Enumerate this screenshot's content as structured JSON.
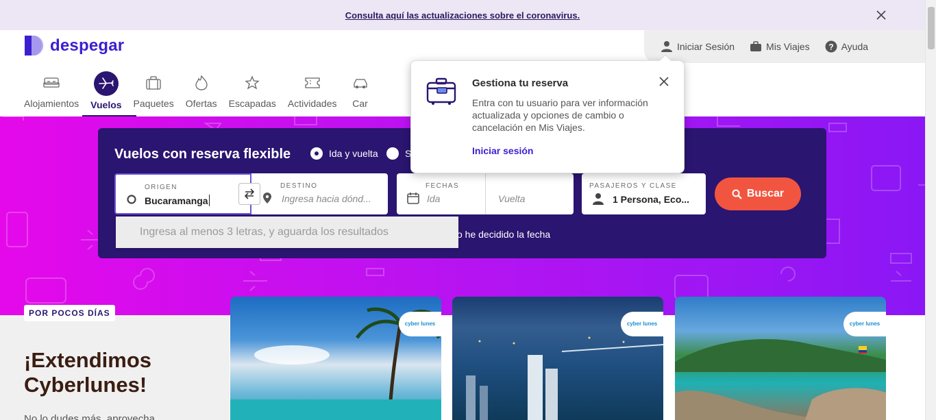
{
  "banner": {
    "link": "Consulta aquí las actualizaciones sobre el coronavirus."
  },
  "logo": {
    "text": "despegar"
  },
  "account": {
    "login": "Iniciar Sesión",
    "trips": "Mis Viajes",
    "help": "Ayuda"
  },
  "nav": {
    "items": [
      {
        "label": "Alojamientos",
        "icon": "bed-icon"
      },
      {
        "label": "Vuelos",
        "icon": "plane-icon",
        "active": true
      },
      {
        "label": "Paquetes",
        "icon": "suitcase-icon"
      },
      {
        "label": "Ofertas",
        "icon": "flame-icon"
      },
      {
        "label": "Escapadas",
        "icon": "star-plane-icon"
      },
      {
        "label": "Actividades",
        "icon": "ticket-icon"
      },
      {
        "label": "Car",
        "icon": "car-icon"
      }
    ]
  },
  "search": {
    "title": "Vuelos con reserva flexible",
    "trip_type": {
      "roundtrip": "Ida y vuelta",
      "oneway": "S"
    },
    "origin": {
      "caption": "ORIGEN",
      "value": "Bucaramanga"
    },
    "destination": {
      "caption": "DESTINO",
      "placeholder": "Ingresa hacia dónd..."
    },
    "dates": {
      "caption": "FECHAS",
      "departure": "Ida",
      "return": "Vuelta"
    },
    "passengers": {
      "caption": "PASAJEROS Y CLASE",
      "value": "1 Persona, Eco..."
    },
    "button": "Buscar",
    "no_date": "o he decidido la fecha",
    "suggest": "Ingresa al menos 3 letras, y aguarda los resultados"
  },
  "popover": {
    "title": "Gestiona tu reserva",
    "text": "Entra con tu usuario para ver información actualizada y opciones de cambio o cancelación en Mis Viajes.",
    "link": "Iniciar sesión"
  },
  "promo": {
    "badge": "POR POCOS DÍAS",
    "title": "¡Extendimos Cyberlunes!",
    "subtitle": "No lo dudes más, aprovecha"
  },
  "cards": [
    {
      "tag": "cyber lunes"
    },
    {
      "tag": "cyber lunes"
    },
    {
      "tag": "cyber lunes"
    }
  ],
  "colors": {
    "brand": "#3b1fd1",
    "search_bg": "#2a1570",
    "cta": "#f2553f",
    "hero_start": "#e509ea",
    "hero_end": "#8b17f5"
  }
}
